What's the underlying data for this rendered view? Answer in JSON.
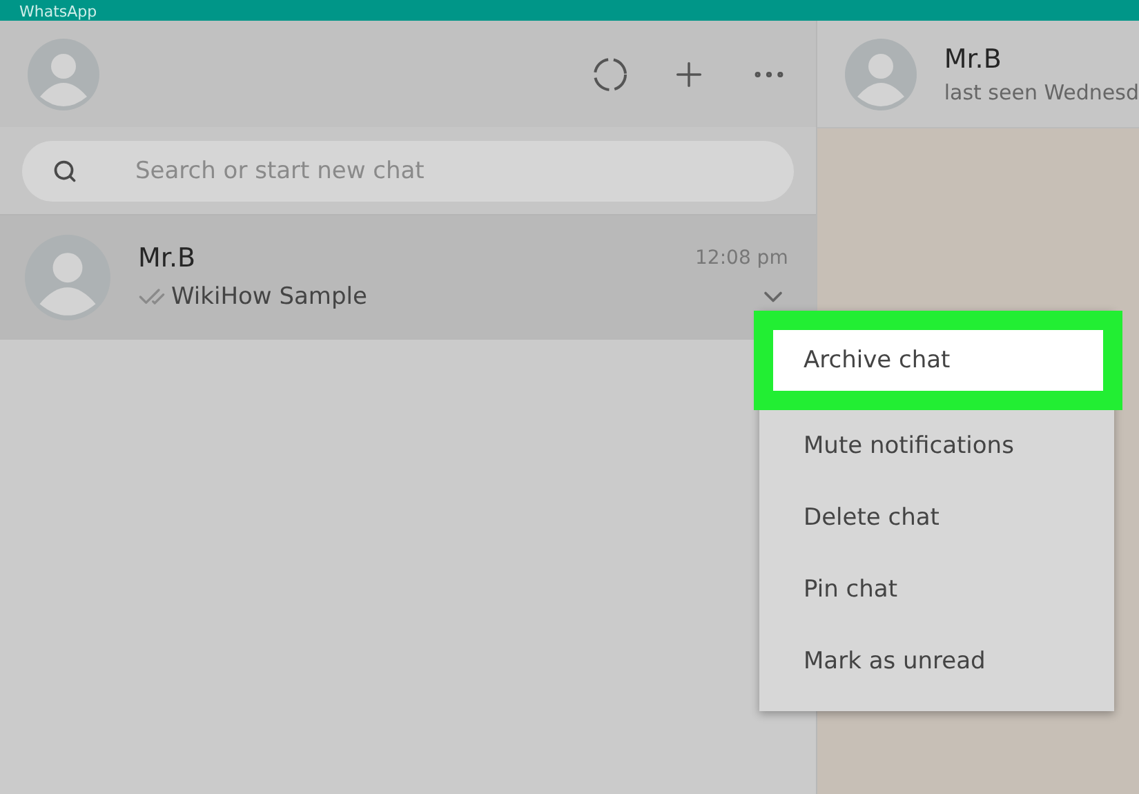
{
  "window": {
    "title": "WhatsApp"
  },
  "sidebar": {
    "search": {
      "placeholder": "Search or start new chat"
    },
    "chats": [
      {
        "name": "Mr.B",
        "time": "12:08 pm",
        "preview": "WikiHow Sample",
        "read": true,
        "selected": true
      }
    ]
  },
  "conversation": {
    "name": "Mr.B",
    "status": "last seen Wednesd"
  },
  "context_menu": {
    "items": [
      {
        "label": "Archive chat",
        "highlighted": true
      },
      {
        "label": "Mute notifications",
        "highlighted": false
      },
      {
        "label": "Delete chat",
        "highlighted": false
      },
      {
        "label": "Pin chat",
        "highlighted": false
      },
      {
        "label": "Mark as unread",
        "highlighted": false
      }
    ]
  }
}
